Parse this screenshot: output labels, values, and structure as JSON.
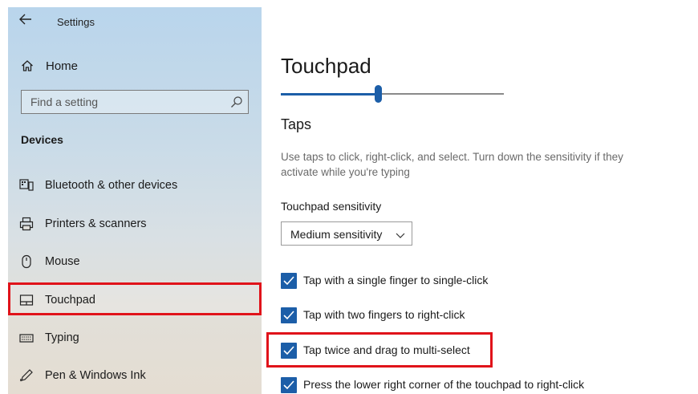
{
  "window": {
    "title": "Settings"
  },
  "sidebar": {
    "home_label": "Home",
    "search": {
      "placeholder": "Find a setting"
    },
    "section_header": "Devices",
    "items": [
      {
        "label": "Bluetooth & other devices",
        "icon": "bluetooth-devices-icon"
      },
      {
        "label": "Printers & scanners",
        "icon": "printer-icon"
      },
      {
        "label": "Mouse",
        "icon": "mouse-icon"
      },
      {
        "label": "Touchpad",
        "icon": "touchpad-icon",
        "selected": true
      },
      {
        "label": "Typing",
        "icon": "keyboard-icon"
      },
      {
        "label": "Pen & Windows Ink",
        "icon": "pen-icon"
      }
    ]
  },
  "main": {
    "title": "Touchpad",
    "slider": {
      "value_fraction": 0.44
    },
    "taps": {
      "title": "Taps",
      "description": "Use taps to click, right-click, and select. Turn down the sensitivity if they activate while you're typing",
      "sensitivity_label": "Touchpad sensitivity",
      "sensitivity_value": "Medium sensitivity",
      "options": [
        {
          "label": "Tap with a single finger to single-click",
          "checked": true
        },
        {
          "label": "Tap with two fingers to right-click",
          "checked": true
        },
        {
          "label": "Tap twice and drag to multi-select",
          "checked": true
        },
        {
          "label": "Press the lower right corner of the touchpad to right-click",
          "checked": true
        }
      ]
    }
  },
  "colors": {
    "accent": "#1c5ea8",
    "highlight": "#e0131a"
  }
}
